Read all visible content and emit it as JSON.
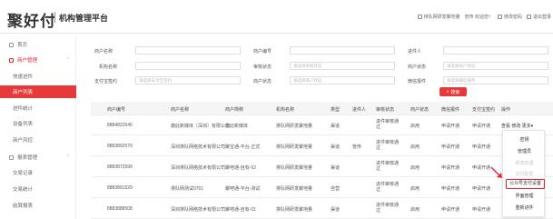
{
  "header": {
    "logo": "聚好付",
    "platform": "机构管理平台",
    "actions": [
      "排队网研发聚地量",
      "管传 欢迎您！",
      "修改密码",
      "退出登录"
    ]
  },
  "sidebar": {
    "items": [
      {
        "label": "首页",
        "kind": "top"
      },
      {
        "label": "商户管理",
        "kind": "top-open",
        "arrow": "^"
      },
      {
        "label": "快速进件",
        "kind": "sub"
      },
      {
        "label": "商户列表",
        "kind": "sub-active"
      },
      {
        "label": "进件统计",
        "kind": "sub"
      },
      {
        "label": "设备列表",
        "kind": "sub"
      },
      {
        "label": "商户风控",
        "kind": "sub"
      },
      {
        "label": "报表管理",
        "kind": "top",
        "arrow": "^"
      },
      {
        "label": "交易记录",
        "kind": "sub"
      },
      {
        "label": "交易统计",
        "kind": "sub"
      },
      {
        "label": "结算报表",
        "kind": "sub"
      }
    ]
  },
  "filters": {
    "row1": {
      "l1": "商户名称",
      "l2": "商户编号",
      "l3": "进件人"
    },
    "row2": {
      "l1": "机构名称",
      "l2": "审核状态",
      "p2": "请选择审核状态",
      "l3": "商户状态",
      "p3": "请选择商户状态"
    },
    "row3": {
      "l1": "支付宝签约",
      "p1": "请选择支付宝签约",
      "l2": "商户状态",
      "p2": "请选择商户状态",
      "l3": "微信报件",
      "p3": "请选择微信报件"
    },
    "search": "搜索"
  },
  "table": {
    "headers": [
      "商户编号",
      "商户名称",
      "商户简称",
      "机构名称",
      "类型",
      "进件人",
      "审核状态",
      "商户状态",
      "微信报件",
      "支付宝签约",
      "操作"
    ],
    "rows": [
      {
        "id": "8884822640",
        "name": "康此新媒体（深圳）有限公司",
        "short": "康此新媒体",
        "org": "排队网研发聚地量",
        "type": "渠道",
        "agent": "",
        "audit": "进件审核通过",
        "status": "启用",
        "wx": "申请开通",
        "ali": "申请开通",
        "ops": "查看  修改  更多▾"
      },
      {
        "id": "8883892579",
        "name": "深圳排队网络技术有限公司",
        "short": "聚宝通-平台-正式",
        "org": "排队网研发聚地量",
        "type": "渠道",
        "agent": "管传",
        "audit": "进件审核通过",
        "status": "启用",
        "wx": "申请开通",
        "ali": "申请开通",
        "ops": ""
      },
      {
        "id": "8883872599",
        "name": "深圳排队网络技术有限公司",
        "short": "聚吧通-自有-02",
        "org": "排队网研发聚地量",
        "type": "渠道",
        "agent": "",
        "audit": "进件审核通过",
        "status": "启用",
        "wx": "申请开通",
        "ali": "申请开通",
        "ops": ""
      },
      {
        "id": "8883891529",
        "name": "排队网测试0701",
        "short": "聚吧通-平台-测试",
        "org": "排队网研发聚地量",
        "type": "自营",
        "agent": "",
        "audit": "进件审核通过",
        "status": "启用",
        "wx": "申请开通",
        "ali": "申请开通",
        "ops": ""
      },
      {
        "id": "8883888508",
        "name": "深圳排队网络技术有限公司",
        "short": "聚吧通-自有-01",
        "org": "排队网研发聚地量",
        "type": "渠道",
        "agent": "",
        "audit": "进件审核通过",
        "status": "启用",
        "wx": "申请开通",
        "ali": "申请开通",
        "ops": ""
      }
    ]
  },
  "dropdown": {
    "items": [
      {
        "label": "密钥",
        "disabled": false
      },
      {
        "label": "管理员",
        "disabled": false
      },
      {
        "label": "终端管理",
        "disabled": true
      },
      {
        "label": "支付配置",
        "disabled": true
      },
      {
        "label": "公众号支付设置",
        "highlight": true
      },
      {
        "label": "界面管理",
        "disabled": false
      },
      {
        "label": "重新进件",
        "disabled": false
      }
    ]
  },
  "colors": {
    "accent": "#e63a3a",
    "header_bg": "#f5f5f5"
  }
}
